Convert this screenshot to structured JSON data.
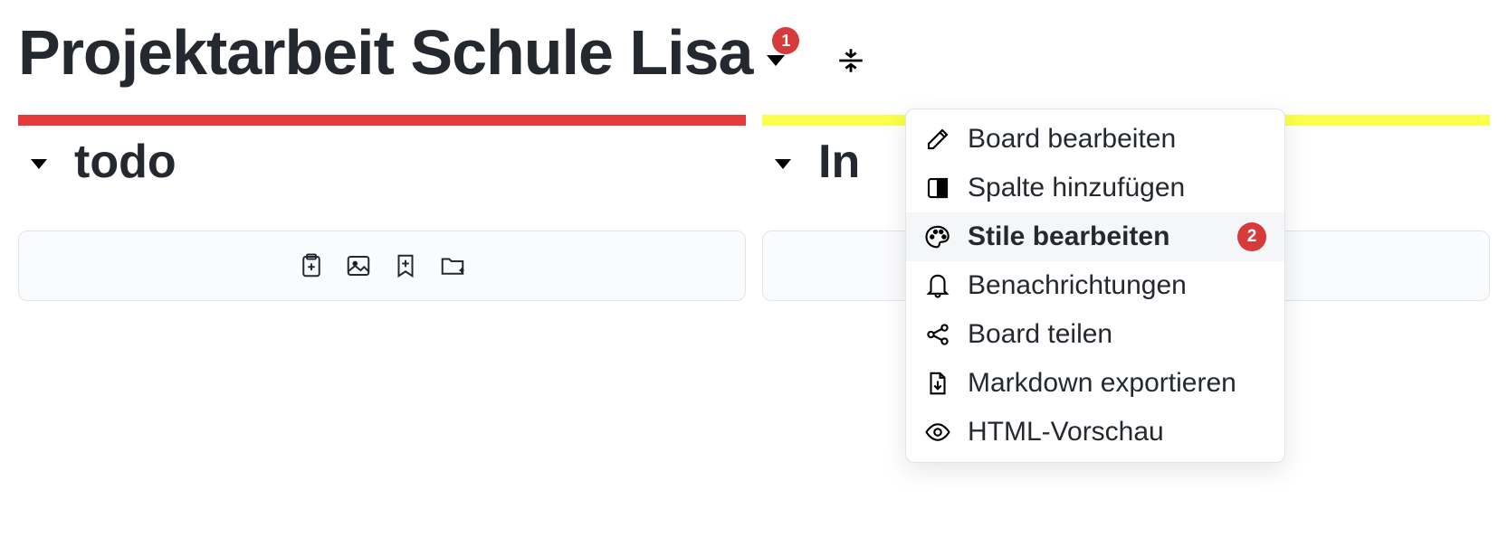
{
  "board": {
    "title": "Projektarbeit Schule Lisa",
    "menu_badge": "1"
  },
  "columns": [
    {
      "title": "todo",
      "color": "#e63939"
    },
    {
      "title": "In",
      "color": "#faff4a"
    }
  ],
  "menu": {
    "items": [
      {
        "icon": "pencil-icon",
        "label": "Board bearbeiten",
        "highlighted": false,
        "badge": null
      },
      {
        "icon": "column-icon",
        "label": "Spalte hinzufügen",
        "highlighted": false,
        "badge": null
      },
      {
        "icon": "palette-icon",
        "label": "Stile bearbeiten",
        "highlighted": true,
        "badge": "2"
      },
      {
        "icon": "bell-icon",
        "label": "Benachrichtungen",
        "highlighted": false,
        "badge": null
      },
      {
        "icon": "share-icon",
        "label": "Board teilen",
        "highlighted": false,
        "badge": null
      },
      {
        "icon": "file-down-icon",
        "label": "Markdown exportieren",
        "highlighted": false,
        "badge": null
      },
      {
        "icon": "eye-icon",
        "label": "HTML-Vorschau",
        "highlighted": false,
        "badge": null
      }
    ]
  },
  "card_actions": {
    "clipboard": "clipboard-plus-icon",
    "image": "image-icon",
    "bookmark": "bookmark-plus-icon",
    "folder": "folder-plus-icon"
  }
}
